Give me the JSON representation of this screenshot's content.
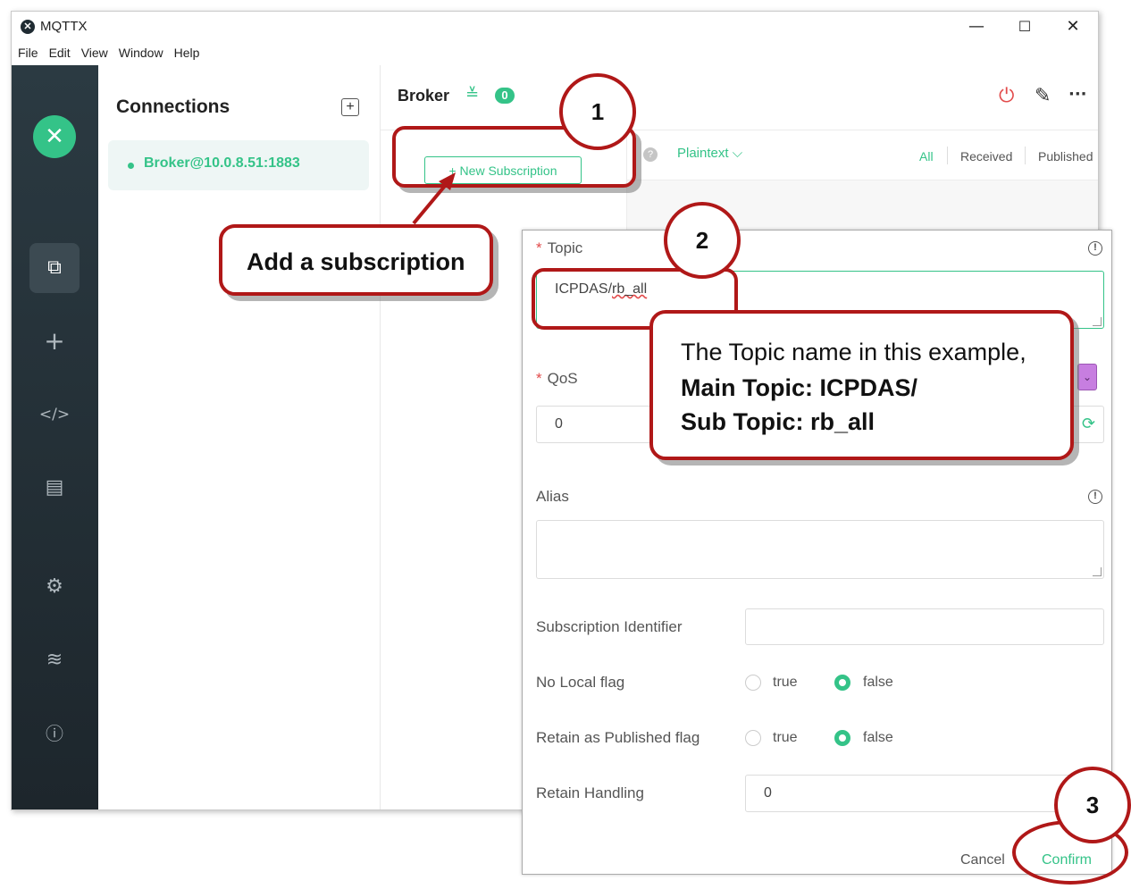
{
  "window": {
    "title": "MQTTX",
    "minimize": "—",
    "maximize": "☐",
    "close": "✕"
  },
  "menu": [
    "File",
    "Edit",
    "View",
    "Window",
    "Help"
  ],
  "sidebar": {
    "logo": "✕",
    "items": [
      {
        "name": "connections-icon",
        "glyph": "⧉"
      },
      {
        "name": "new-connection-icon",
        "glyph": "+"
      },
      {
        "name": "script-icon",
        "glyph": "</>"
      },
      {
        "name": "log-icon",
        "glyph": "▤"
      },
      {
        "name": "settings-icon",
        "glyph": "⚙"
      },
      {
        "name": "feed-icon",
        "glyph": "≋"
      },
      {
        "name": "about-icon",
        "glyph": "ⓘ"
      }
    ]
  },
  "connections": {
    "title": "Connections",
    "add_icon": "+",
    "items": [
      {
        "label": "Broker@10.0.8.51:1883",
        "status_color": "#34c388"
      }
    ]
  },
  "broker": {
    "name": "Broker",
    "chevron": "≚",
    "badge": "0",
    "power_icon": "⏻",
    "edit_icon": "✎",
    "more_icon": "···"
  },
  "subscriptions": {
    "new_button": "+ New Subscription"
  },
  "messages": {
    "help_icon": "?",
    "format": "Plaintext ⌵",
    "filters": [
      "All",
      "Received",
      "Published"
    ],
    "active_filter": "All"
  },
  "dialog": {
    "topic_label": "Topic",
    "topic_value_prefix": "ICPDAS/",
    "topic_value_suffix": "rb_all",
    "qos_label": "QoS",
    "qos_value": "0",
    "alias_label": "Alias",
    "sub_id_label": "Subscription Identifier",
    "no_local_label": "No Local flag",
    "retain_pub_label": "Retain as Published flag",
    "retain_handling_label": "Retain Handling",
    "retain_handling_value": "0",
    "true_label": "true",
    "false_label": "false",
    "cancel_label": "Cancel",
    "confirm_label": "Confirm",
    "info_icon": "!",
    "color_dropdown": "⌄",
    "refresh_icon": "⟳",
    "accent_color": "#34c388"
  },
  "annotations": {
    "step1": "1",
    "step2": "2",
    "step3": "3",
    "add_subscription": "Add a subscription",
    "topic_note_line1": "The Topic name in this example,",
    "topic_note_line2": "Main Topic: ICPDAS/",
    "topic_note_line3": "Sub Topic: rb_all",
    "annotation_color": "#b01818"
  }
}
